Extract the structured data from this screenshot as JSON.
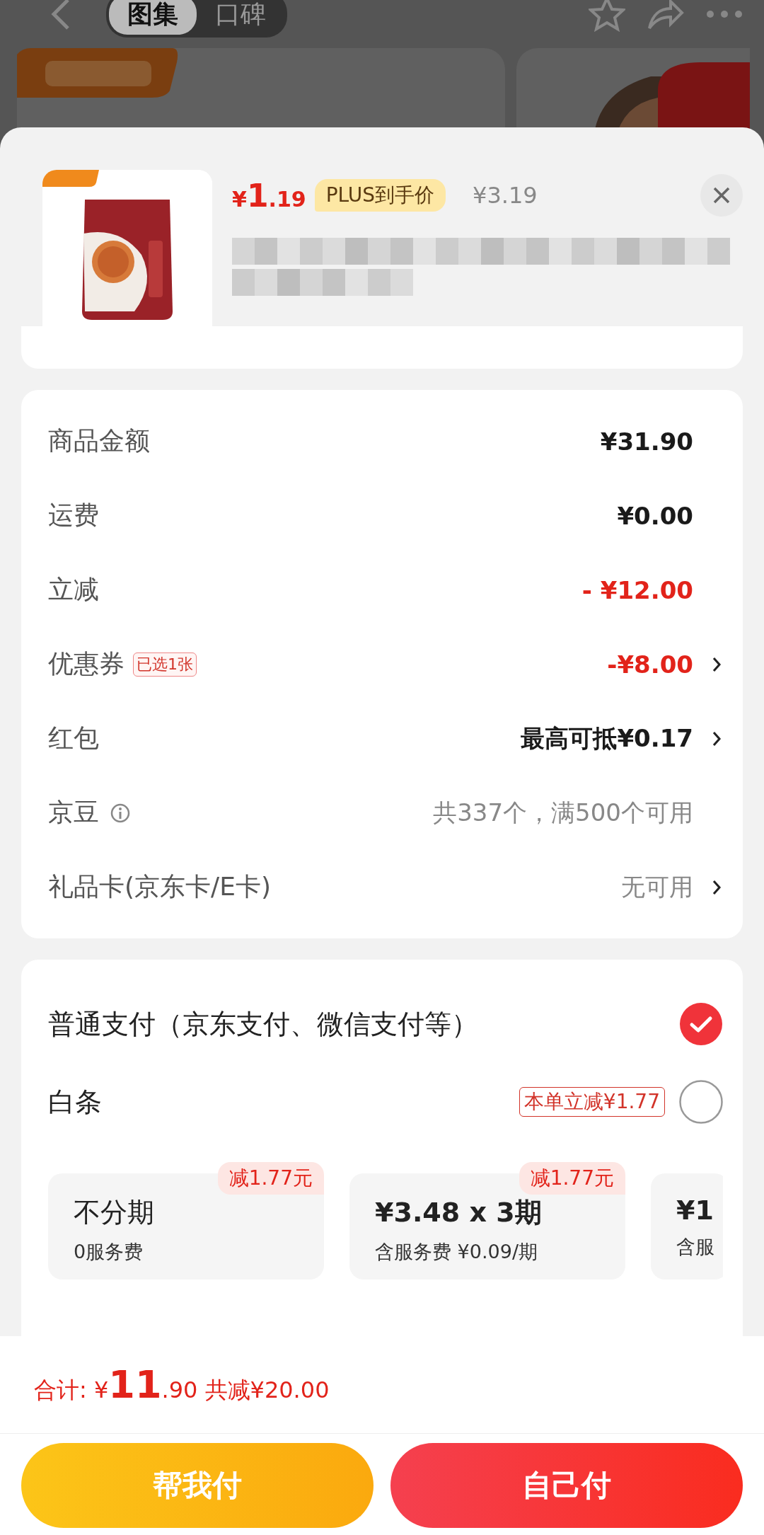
{
  "backdrop": {
    "tabs": [
      {
        "label": "图集",
        "selected": true
      },
      {
        "label": "口碑",
        "selected": false
      }
    ]
  },
  "product": {
    "price_symbol": "¥",
    "price_int": "1",
    "price_dec": ".19",
    "badge": "PLUS到手价",
    "original_price": "¥3.19"
  },
  "fees": [
    {
      "label": "商品金额",
      "info": false,
      "value": "¥31.90",
      "discount": false,
      "muted": false,
      "arrow": false
    },
    {
      "label": "运费",
      "info": false,
      "value": "¥0.00",
      "discount": false,
      "muted": false,
      "arrow": false
    },
    {
      "label": "立减",
      "info": false,
      "value": "- ¥12.00",
      "discount": true,
      "muted": false,
      "arrow": false
    },
    {
      "label": "优惠券",
      "tag": "已选1张",
      "info": false,
      "value": "-¥8.00",
      "discount": true,
      "muted": false,
      "arrow": true
    },
    {
      "label": "红包",
      "info": false,
      "value": "最高可抵¥0.17",
      "discount": false,
      "muted": false,
      "arrow": true
    },
    {
      "label": "京豆",
      "info": true,
      "value": "共337个，满500个可用",
      "discount": false,
      "muted": true,
      "arrow": false
    },
    {
      "label": "礼品卡(京东卡/E卡)",
      "info": false,
      "value": "无可用",
      "discount": false,
      "muted": true,
      "arrow": true
    }
  ],
  "payment": {
    "methods": [
      {
        "label": "普通支付（京东支付、微信支付等）",
        "selected": true
      },
      {
        "label": "白条",
        "tag": "本单立减¥1.77",
        "selected": false
      }
    ],
    "plans": [
      {
        "title": "不分期",
        "sub": "0服务费",
        "tag": "减1.77元"
      },
      {
        "title": "¥3.48 x 3期",
        "sub": "含服务费 ¥0.09/期",
        "tag": "减1.77元"
      },
      {
        "title": "¥1",
        "sub": "含服"
      }
    ]
  },
  "total": {
    "label": "合计:",
    "symbol": "¥",
    "int": "11",
    "dec": ".90",
    "saving": "共减¥20.00"
  },
  "buttons": [
    {
      "label": "帮我付",
      "kind": "secondary"
    },
    {
      "label": "自己付",
      "kind": "primary"
    }
  ]
}
